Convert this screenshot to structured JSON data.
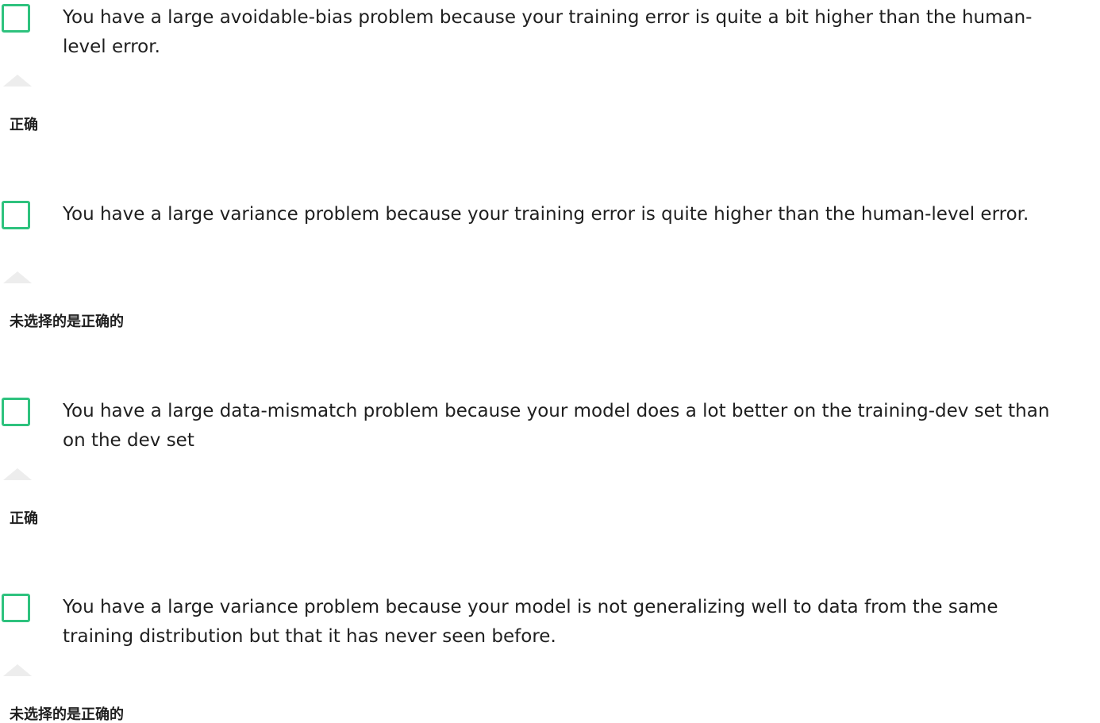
{
  "options": [
    {
      "text": "You have a large avoidable-bias problem because your training error is quite a bit higher than the human-level error.",
      "feedback": "正确"
    },
    {
      "text": "You have a large variance problem because your training error is quite higher than the human-level error.",
      "feedback": "未选择的是正确的"
    },
    {
      "text": "You have a large data-mismatch problem because your model does a lot better on the training-dev set than on the dev set",
      "feedback": "正确"
    },
    {
      "text": "You have a large variance problem because your model is not generalizing well to data from the same training distribution but that it has never seen before.",
      "feedback": "未选择的是正确的"
    }
  ],
  "colors": {
    "checkbox_border": "#2ec27e",
    "feedback_arrow": "#ededed"
  }
}
